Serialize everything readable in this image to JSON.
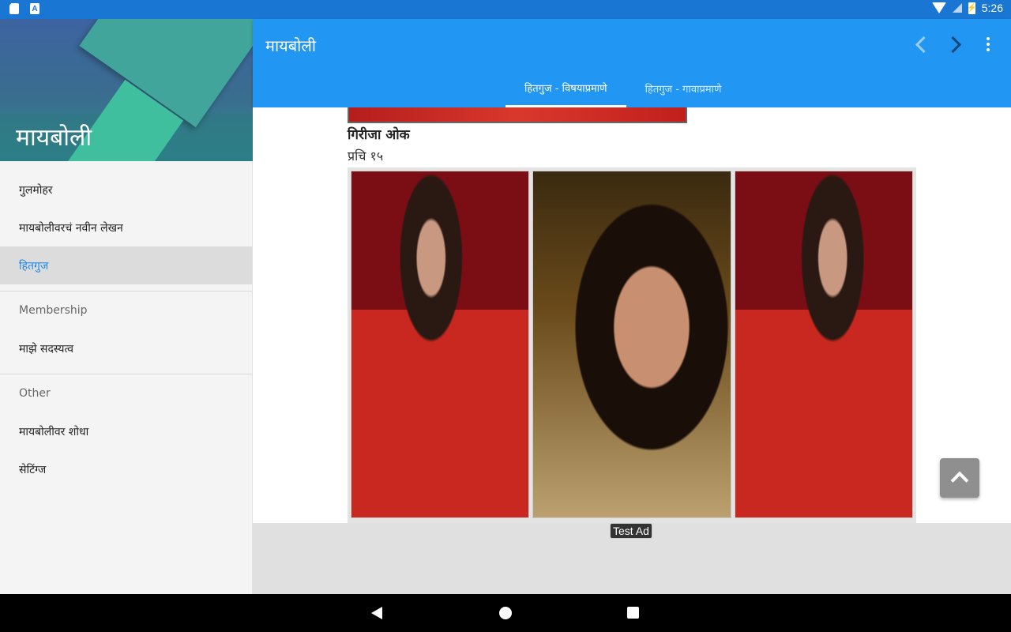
{
  "status_bar": {
    "time": "5:26",
    "left_icons": [
      "sd-card-icon",
      "font-a-icon"
    ],
    "font_icon_text": "A",
    "right_icons": [
      "wifi-icon",
      "signal-icon",
      "battery-charging-icon"
    ],
    "battery_glyph": "⚡"
  },
  "drawer": {
    "title": "मायबोली",
    "items": [
      {
        "label": "गुलमोहर",
        "active": false
      },
      {
        "label": "मायबोलीवरचं नवीन लेखन",
        "active": false
      },
      {
        "label": "हितगुज",
        "active": true
      }
    ],
    "membership_section": "Membership",
    "membership_items": [
      {
        "label": "माझे सदस्यत्व"
      }
    ],
    "other_section": "Other",
    "other_items": [
      {
        "label": "मायबोलीवर शोधा"
      },
      {
        "label": "सेटिंग्ज"
      }
    ]
  },
  "appbar": {
    "title": "मायबोली",
    "actions": [
      "chevron-left-icon",
      "chevron-right-icon",
      "more-vert-icon"
    ],
    "tabs": [
      {
        "label": "हितगुज - विषयाप्रमाणे",
        "active": true
      },
      {
        "label": "हितगुज - गावाप्रमाणे",
        "active": false
      }
    ]
  },
  "content": {
    "author": "गिरीजा ओक",
    "caption": "प्रचि १५",
    "photos": [
      "woman-red-saree-photo",
      "woman-closeup-photo",
      "woman-red-saree-photo"
    ]
  },
  "ad": {
    "label": "Test Ad"
  },
  "colors": {
    "status_bar": "#1976d2",
    "app_bar": "#2196f3",
    "accent": "#1e88e5",
    "drawer_bg": "#f4f4f4"
  }
}
